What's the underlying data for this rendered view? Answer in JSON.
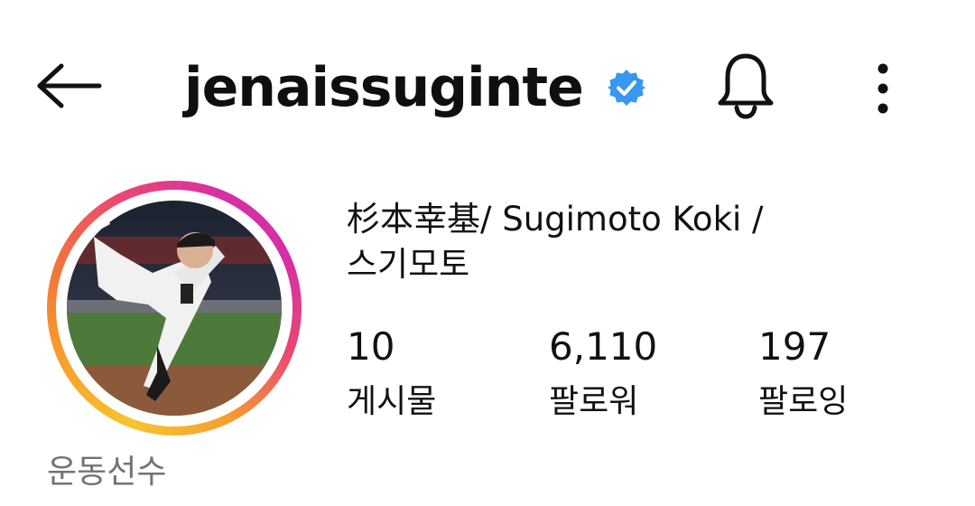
{
  "header": {
    "username": "jenaissuginte",
    "verified_color": "#3897f0",
    "icons": [
      "back-arrow-icon",
      "verified-badge-icon",
      "bell-icon",
      "more-vertical-icon"
    ]
  },
  "profile": {
    "full_name_line1": "杉本幸基/ Sugimoto Koki /",
    "full_name_line2": "스기모토",
    "category": "운동선수",
    "avatar_ring_colors": [
      "#f7c430",
      "#f2733a",
      "#d52ea8"
    ]
  },
  "stats": {
    "posts": {
      "value": "10",
      "label": "게시물"
    },
    "followers": {
      "value": "6,110",
      "label": "팔로워"
    },
    "following": {
      "value": "197",
      "label": "팔로잉"
    }
  }
}
